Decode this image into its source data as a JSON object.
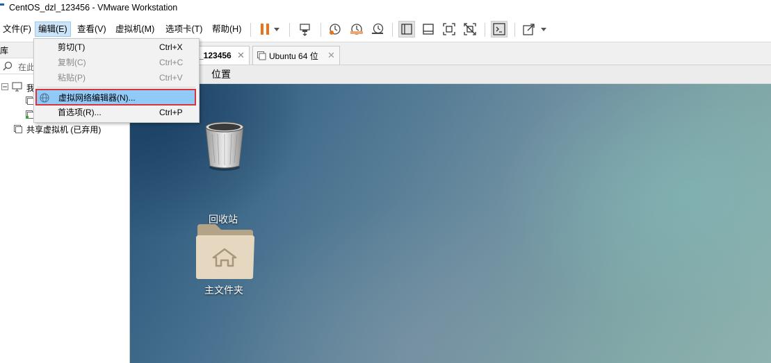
{
  "window": {
    "title": "CentOS_dzl_123456 - VMware Workstation"
  },
  "menubar": {
    "items": [
      "文件(F)",
      "编辑(E)",
      "查看(V)",
      "虚拟机(M)",
      "选项卡(T)",
      "帮助(H)"
    ]
  },
  "toolbar": {
    "icons": [
      "pause-icon",
      "dropdown-arrow-icon",
      "send-ctrl-alt-del-icon",
      "snapshot-icon",
      "revert-snapshot-icon",
      "snapshot-manager-icon",
      "library-view-icon",
      "thumbnail-bar-icon",
      "fullscreen-icon",
      "unity-icon",
      "console-view-icon",
      "stretch-icon"
    ]
  },
  "library": {
    "header_partial": "库",
    "search_partial": "在此",
    "tree": [
      {
        "label": "我",
        "level": 0
      },
      {
        "label": "",
        "level": 1
      },
      {
        "label": "",
        "level": 1
      },
      {
        "label": "共享虚拟机 (已弃用)",
        "level": 0
      }
    ]
  },
  "tabs": [
    {
      "label": "_123456",
      "active": true
    },
    {
      "label": "Ubuntu 64 位",
      "active": false
    }
  ],
  "guest_menu": {
    "places": "位置"
  },
  "desktop": {
    "icons": [
      {
        "label": "回收站",
        "icon": "trash-icon"
      },
      {
        "label": "主文件夹",
        "icon": "home-folder-icon"
      }
    ]
  },
  "edit_menu": {
    "items": [
      {
        "label": "剪切(T)",
        "shortcut": "Ctrl+X",
        "enabled": true
      },
      {
        "label": "复制(C)",
        "shortcut": "Ctrl+C",
        "enabled": false
      },
      {
        "label": "粘贴(P)",
        "shortcut": "Ctrl+V",
        "enabled": false
      },
      {
        "label": "虚拟网络编辑器(N)...",
        "shortcut": "",
        "enabled": true,
        "highlighted": true
      },
      {
        "label": "首选项(R)...",
        "shortcut": "Ctrl+P",
        "enabled": true
      }
    ]
  },
  "colors": {
    "pause": "#e8731a",
    "highlight": "#91c9f7",
    "highlight_border": "#d8323a"
  }
}
